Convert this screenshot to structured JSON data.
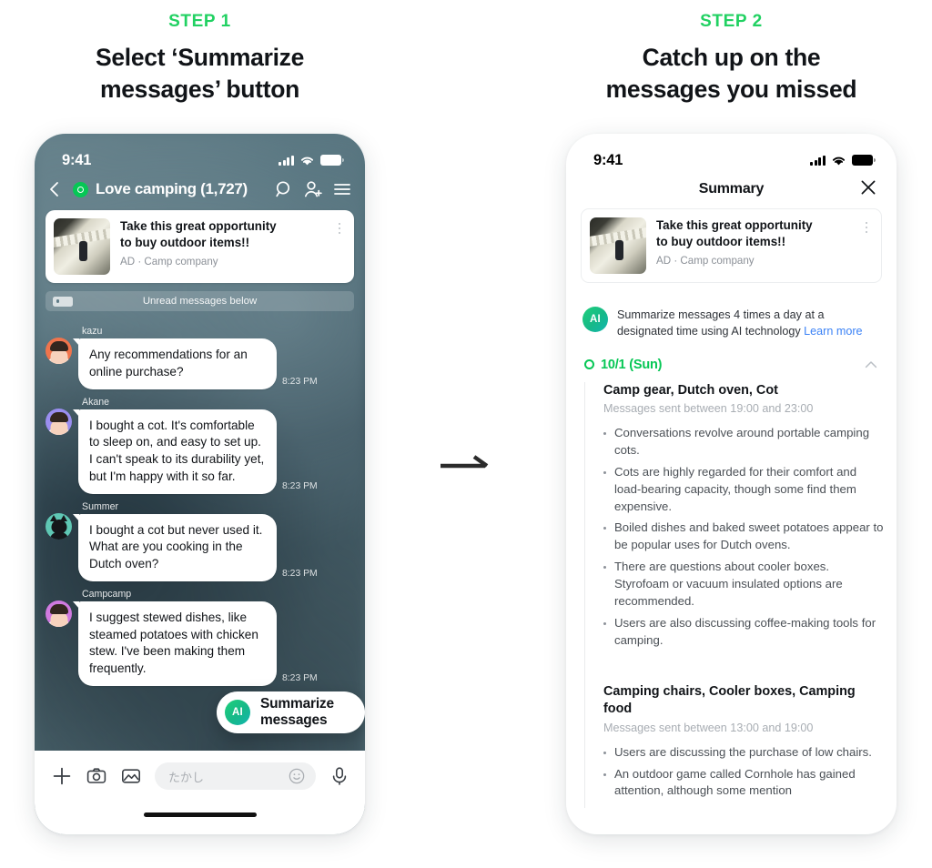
{
  "steps": [
    {
      "kicker": "STEP 1",
      "title_line1": "Select ‘Summarize",
      "title_line2": "messages’ button"
    },
    {
      "kicker": "STEP 2",
      "title_line1": "Catch up on the",
      "title_line2": "messages you missed"
    }
  ],
  "colors": {
    "accent_green": "#21d162",
    "line_green": "#06c755",
    "link_blue": "#3b82f6",
    "text_dark": "#111418"
  },
  "phone1": {
    "status": {
      "time": "9:41"
    },
    "chat_header": {
      "title": "Love camping (1,727)",
      "back_icon": "chevron-left-icon",
      "search_icon": "search-icon",
      "add_friend_icon": "add-friend-icon",
      "menu_icon": "hamburger-menu-icon"
    },
    "ad": {
      "title_line1": "Take this great opportunity",
      "title_line2": "to buy outdoor items!!",
      "meta": "AD · Camp company",
      "more_icon": "more-vertical-icon"
    },
    "unread": {
      "label": "Unread messages below"
    },
    "messages": [
      {
        "name": "kazu",
        "text": "Any recommendations for an online purchase?",
        "time": "8:23 PM",
        "avatar": "avatar-kazu"
      },
      {
        "name": "Akane",
        "text": "I bought a cot. It's comfortable to sleep on, and easy to set up. I can't speak to its durability yet, but I'm happy with it so far.",
        "time": "8:23 PM",
        "avatar": "avatar-akane"
      },
      {
        "name": "Summer",
        "text": "I bought a cot but never used it. What are you cooking in the Dutch oven?",
        "time": "8:23 PM",
        "avatar": "avatar-summer"
      },
      {
        "name": "Campcamp",
        "text": "I suggest stewed dishes, like steamed potatoes with chicken stew. I've been making them frequently.",
        "time": "8:23 PM",
        "avatar": "avatar-campcamp"
      }
    ],
    "summarize_button": {
      "badge": "AI",
      "label": "Summarize messages"
    },
    "composer": {
      "plus_icon": "plus-icon",
      "camera_icon": "camera-icon",
      "gallery_icon": "gallery-icon",
      "placeholder": "たかし",
      "emoji_icon": "emoji-smile-icon",
      "mic_icon": "microphone-icon"
    }
  },
  "phone2": {
    "status": {
      "time": "9:41"
    },
    "header": {
      "title": "Summary",
      "close_icon": "close-icon"
    },
    "ad": {
      "title_line1": "Take this great opportunity",
      "title_line2": "to buy outdoor items!!",
      "meta": "AD · Camp company",
      "more_icon": "more-vertical-icon"
    },
    "ai_note": {
      "badge": "AI",
      "text": "Summarize messages 4 times a day at a designated time using AI technology",
      "link": "Learn more"
    },
    "date_group": {
      "label": "10/1 (Sun)",
      "collapse_icon": "chevron-up-icon"
    },
    "sections": [
      {
        "title": "Camp gear, Dutch oven, Cot",
        "subtitle": "Messages sent between 19:00 and 23:00",
        "bullets": [
          "Conversations revolve around portable camping cots.",
          "Cots are highly regarded for their comfort and load-bearing capacity, though some find them expensive.",
          "Boiled dishes and baked sweet potatoes appear to be popular uses for Dutch ovens.",
          "There are questions about cooler boxes. Styrofoam or vacuum insulated options are recommended.",
          "Users are also discussing coffee-making tools for camping."
        ]
      },
      {
        "title": "Camping chairs, Cooler boxes, Camping food",
        "subtitle": "Messages sent between 13:00 and 19:00",
        "bullets": [
          "Users are discussing the purchase of low chairs.",
          "An outdoor game called Cornhole has gained attention, although some mention"
        ]
      }
    ]
  }
}
